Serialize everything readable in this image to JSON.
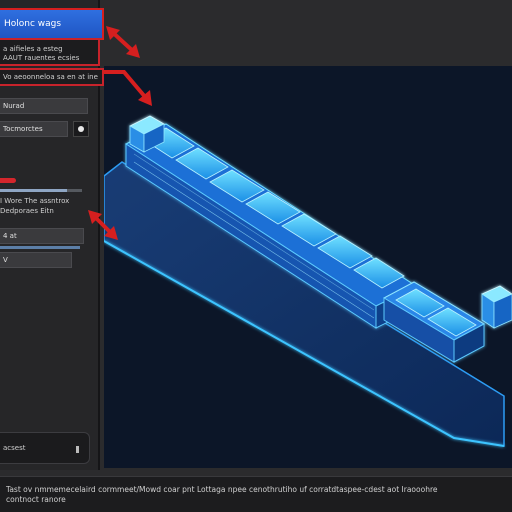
{
  "sidebar": {
    "title": "Holonc wags",
    "description_lines": [
      "a aifieles a esteg",
      "AAUT rauentes ecsies"
    ],
    "path": "Vo aeoonneloa sa en at ine",
    "field_1": "Nurad",
    "field_2": "Tocmorctes",
    "radio_selected": true,
    "slider_value": 0.82,
    "info_lines": [
      "I Wore The assntrox",
      "Dedporaes Eitn"
    ],
    "field_4": "4 at",
    "field_5": "V",
    "bottom_field": "acsest"
  },
  "status_bar": {
    "lines": [
      "Tast ov nmmemecelaird cormmeet/Mowd coar pnt Lottaga npee cenothrutiho uf corratdtaspee-cdest aot Iraooohre",
      "contnoct ranore"
    ]
  },
  "colors": {
    "title_bar": "#2563d8",
    "annotation_red": "#d61f1f",
    "viewport_bg": "#0c1628",
    "model_glow": "#2fb6ff"
  },
  "icons": [
    "radio-dot-icon",
    "arrow-icon"
  ]
}
